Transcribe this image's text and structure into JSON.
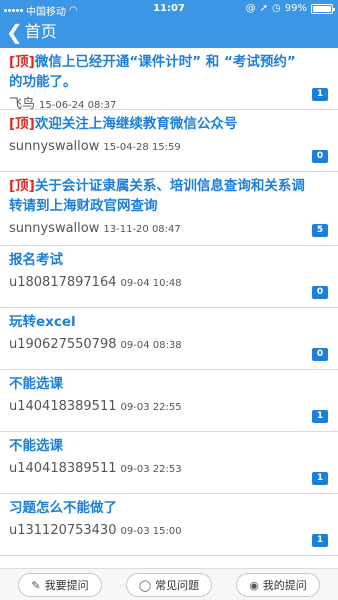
{
  "status_bar": {
    "carrier": "中国移动",
    "wifi_icon": "wifi-icon",
    "time": "11:07",
    "battery": "99%",
    "battery_level": 0.99
  },
  "nav": {
    "back_icon": "chevron-left-icon",
    "title": "首页"
  },
  "items": [
    {
      "tag": "[顶]",
      "title": "微信上已经开通“课件计时” 和 “考试预约” 的功能了。",
      "user": "飞鸟",
      "date": "15-06-24 08:37",
      "count": "1"
    },
    {
      "tag": "[顶]",
      "title": "欢迎关注上海继续教育微信公众号",
      "user": "sunnyswallow",
      "date": "15-04-28 15:59",
      "count": "0"
    },
    {
      "tag": "[顶]",
      "title": "关于会计证隶属关系、培训信息查询和关系调转请到上海财政官网查询",
      "user": "sunnyswallow",
      "date": "13-11-20 08:47",
      "count": "5"
    },
    {
      "tag": "",
      "title": "报名考试",
      "user": "u180817897164",
      "date": "09-04 10:48",
      "count": "0"
    },
    {
      "tag": "",
      "title": "玩转excel",
      "user": "u190627550798",
      "date": "09-04 08:38",
      "count": "0"
    },
    {
      "tag": "",
      "title": "不能选课",
      "user": "u140418389511",
      "date": "09-03 22:55",
      "count": "1"
    },
    {
      "tag": "",
      "title": "不能选课",
      "user": "u140418389511",
      "date": "09-03 22:53",
      "count": "1"
    },
    {
      "tag": "",
      "title": "习题怎么不能做了",
      "user": "u131120753430",
      "date": "09-03 15:00",
      "count": "1"
    }
  ],
  "bottom": {
    "ask_label": "我要提问",
    "ask_icon": "edit-icon",
    "faq_label": "常见问题",
    "faq_icon": "chat-bubble-icon",
    "my_label": "我的提问",
    "my_icon": "user-icon"
  }
}
